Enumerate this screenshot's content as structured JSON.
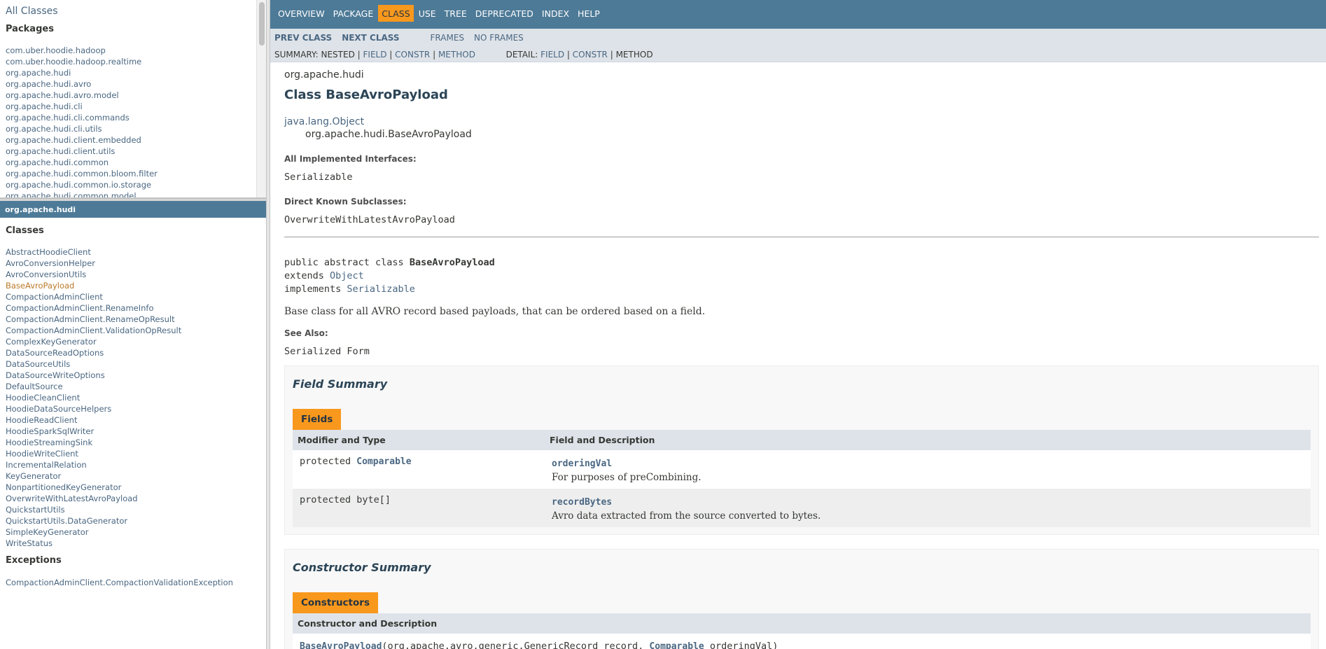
{
  "left_top": {
    "all_classes": "All Classes",
    "packages_header": "Packages",
    "packages": [
      "com.uber.hoodie.hadoop",
      "com.uber.hoodie.hadoop.realtime",
      "org.apache.hudi",
      "org.apache.hudi.avro",
      "org.apache.hudi.avro.model",
      "org.apache.hudi.cli",
      "org.apache.hudi.cli.commands",
      "org.apache.hudi.cli.utils",
      "org.apache.hudi.client.embedded",
      "org.apache.hudi.client.utils",
      "org.apache.hudi.common",
      "org.apache.hudi.common.bloom.filter",
      "org.apache.hudi.common.io.storage",
      "org.apache.hudi.common.model"
    ]
  },
  "left_bottom": {
    "package_bar": "org.apache.hudi",
    "classes_header": "Classes",
    "classes": [
      "AbstractHoodieClient",
      "AvroConversionHelper",
      "AvroConversionUtils",
      "BaseAvroPayload",
      "CompactionAdminClient",
      "CompactionAdminClient.RenameInfo",
      "CompactionAdminClient.RenameOpResult",
      "CompactionAdminClient.ValidationOpResult",
      "ComplexKeyGenerator",
      "DataSourceReadOptions",
      "DataSourceUtils",
      "DataSourceWriteOptions",
      "DefaultSource",
      "HoodieCleanClient",
      "HoodieDataSourceHelpers",
      "HoodieReadClient",
      "HoodieSparkSqlWriter",
      "HoodieStreamingSink",
      "HoodieWriteClient",
      "IncrementalRelation",
      "KeyGenerator",
      "NonpartitionedKeyGenerator",
      "OverwriteWithLatestAvroPayload",
      "QuickstartUtils",
      "QuickstartUtils.DataGenerator",
      "SimpleKeyGenerator",
      "WriteStatus"
    ],
    "current_class": "BaseAvroPayload",
    "exceptions_header": "Exceptions",
    "exceptions": [
      "CompactionAdminClient.CompactionValidationException"
    ]
  },
  "nav": {
    "top": [
      "OVERVIEW",
      "PACKAGE",
      "CLASS",
      "USE",
      "TREE",
      "DEPRECATED",
      "INDEX",
      "HELP"
    ],
    "active": "CLASS",
    "prev_class": "PREV CLASS",
    "next_class": "NEXT CLASS",
    "frames": "FRAMES",
    "no_frames": "NO FRAMES",
    "summary_label": "SUMMARY: NESTED |",
    "summary_field": "FIELD",
    "sep1": "|",
    "summary_constr": "CONSTR",
    "sep2": "|",
    "summary_method": "METHOD",
    "detail_label": "DETAIL:",
    "detail_field": "FIELD",
    "sep3": "|",
    "detail_constr": "CONSTR",
    "sep4": "|",
    "detail_method": "METHOD"
  },
  "content": {
    "package": "org.apache.hudi",
    "title": "Class BaseAvroPayload",
    "inherit_parent": "java.lang.Object",
    "inherit_child": "org.apache.hudi.BaseAvroPayload",
    "interfaces_label": "All Implemented Interfaces:",
    "interfaces": "Serializable",
    "subclasses_label": "Direct Known Subclasses:",
    "subclasses": "OverwriteWithLatestAvroPayload",
    "sig_line1_prefix": "public abstract class ",
    "sig_line1_name": "BaseAvroPayload",
    "sig_line2_prefix": "extends ",
    "sig_line2_link": "Object",
    "sig_line3_prefix": "implements ",
    "sig_line3_link": "Serializable",
    "description": "Base class for all AVRO record based payloads, that can be ordered based on a field.",
    "see_also_label": "See Also:",
    "see_also": "Serialized Form"
  },
  "field_summary": {
    "title": "Field Summary",
    "caption": "Fields",
    "col1": "Modifier and Type",
    "col2": "Field and Description",
    "rows": [
      {
        "modifier": "protected ",
        "type": "Comparable",
        "name": "orderingVal",
        "desc": "For purposes of preCombining."
      },
      {
        "modifier": "protected byte[]",
        "type": "",
        "name": "recordBytes",
        "desc": "Avro data extracted from the source converted to bytes."
      }
    ]
  },
  "constructor_summary": {
    "title": "Constructor Summary",
    "caption": "Constructors",
    "col1": "Constructor and Description",
    "ctor_name": "BaseAvroPayload",
    "ctor_args_1": "(org.apache.avro.generic.GenericRecord record, ",
    "ctor_type": "Comparable",
    "ctor_args_2": " orderingVal)"
  },
  "colors": {
    "nav_bg": "#4d7a97",
    "subnav_bg": "#dee3e9",
    "accent": "#f8981d",
    "link": "#4a6782",
    "current": "#bb7a2a"
  }
}
